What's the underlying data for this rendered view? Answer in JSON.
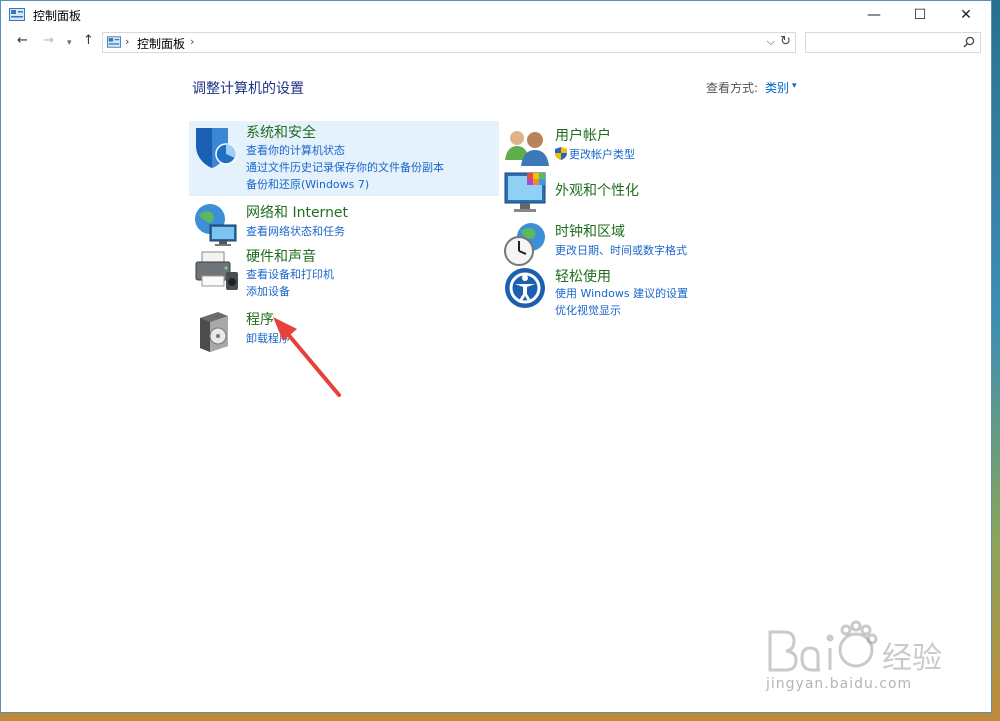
{
  "window": {
    "title": "控制面板"
  },
  "window_controls": {
    "minimize": "—",
    "maximize": "☐",
    "close": "✕"
  },
  "nav": {
    "back": "←",
    "forward": "→",
    "history": "▾",
    "up": "↑"
  },
  "address": {
    "crumb": "控制面板",
    "separator": "›",
    "dropdown": "⌵",
    "refresh": "↻"
  },
  "search": {
    "placeholder": ""
  },
  "content": {
    "title": "调整计算机的设置",
    "view_by_label": "查看方式:",
    "view_by_value": "类别",
    "view_by_arrow": "▾"
  },
  "categories": [
    {
      "title": "系统和安全",
      "icon": "shield-icon",
      "links": [
        "查看你的计算机状态",
        "通过文件历史记录保存你的文件备份副本",
        "备份和还原(Windows 7)"
      ]
    },
    {
      "title": "网络和 Internet",
      "icon": "network-globe-icon",
      "links": [
        "查看网络状态和任务"
      ]
    },
    {
      "title": "硬件和声音",
      "icon": "printer-speaker-icon",
      "links": [
        "查看设备和打印机",
        "添加设备"
      ]
    },
    {
      "title": "程序",
      "icon": "programs-disc-icon",
      "links": [
        "卸载程序"
      ]
    },
    {
      "title": "用户帐户",
      "icon": "users-icon",
      "links": [
        "更改帐户类型"
      ]
    },
    {
      "title": "外观和个性化",
      "icon": "monitor-color-icon",
      "links": []
    },
    {
      "title": "时钟和区域",
      "icon": "clock-globe-icon",
      "links": [
        "更改日期、时间或数字格式"
      ]
    },
    {
      "title": "轻松使用",
      "icon": "ease-of-access-icon",
      "links": [
        "使用 Windows 建议的设置",
        "优化视觉显示"
      ]
    }
  ],
  "watermark": {
    "text": "jingyan.baidu.com",
    "logo": "baidu-jingyan-logo"
  },
  "colors": {
    "accent": "#0066cc",
    "category_title": "#1e6e1e",
    "heading": "#1e3287",
    "selected": "#e5f1fb",
    "arrow": "#e8403a"
  }
}
